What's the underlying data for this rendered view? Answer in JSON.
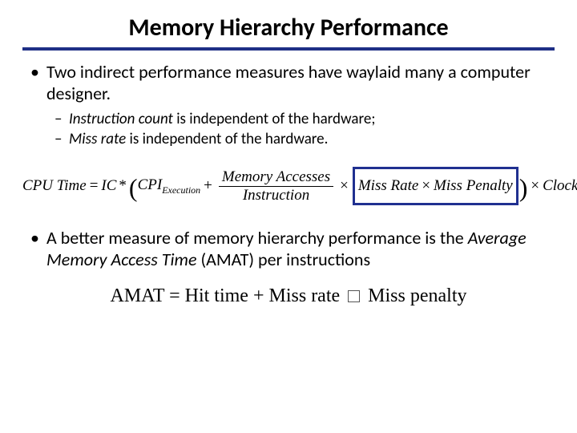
{
  "title": "Memory Hierarchy Performance",
  "bullet1": {
    "text_a": "Two indirect performance measures have waylaid many a computer designer.",
    "sub1_em": "Instruction count",
    "sub1_rest": " is independent of the hardware;",
    "sub2_em": "Miss rate",
    "sub2_rest": " is independent of the hardware."
  },
  "formula": {
    "lhs": "CPU Time",
    "ic": "IC",
    "cpi": "CPI",
    "cpi_sub": "Execution",
    "mem_acc": "Memory Accesses",
    "instr": "Instruction",
    "miss_rate": "Miss Rate",
    "miss_pen": "Miss Penalty",
    "cct": "Clock Cycle Time"
  },
  "bullet2": {
    "lead": "A better measure of memory hierarchy performance is the ",
    "em": "Average Memory Access Time",
    "rest": " (AMAT) per instructions"
  },
  "amat": {
    "lhs": "AMAT",
    "rhs_a": "Hit time",
    "rhs_b": "Miss rate",
    "rhs_c": "Miss penalty"
  }
}
